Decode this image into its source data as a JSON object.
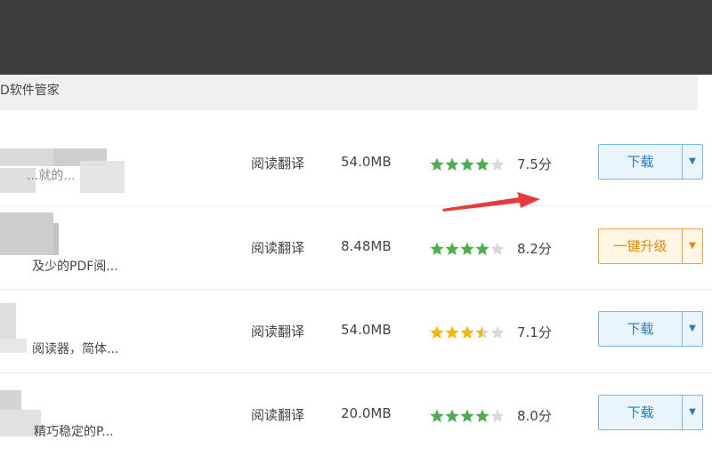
{
  "header": {
    "title": "D软件管家"
  },
  "rows": [
    {
      "desc": "...就的...",
      "category": "阅读翻译",
      "size": "54.0MB",
      "rating": 4,
      "score": "7.5分",
      "action": "下载",
      "action_type": "download"
    },
    {
      "desc": "及少的PDF阅...",
      "category": "阅读翻译",
      "size": "8.48MB",
      "rating": 4,
      "score": "8.2分",
      "action": "一键升级",
      "action_type": "upgrade"
    },
    {
      "desc": "阅读器，简体...",
      "category": "阅读翻译",
      "size": "54.0MB",
      "rating": 3.5,
      "score": "7.1分",
      "action": "下载",
      "action_type": "download"
    },
    {
      "desc": "精巧稳定的P...",
      "category": "阅读翻译",
      "size": "20.0MB",
      "rating": 4,
      "score": "8.0分",
      "action": "下载",
      "action_type": "download"
    }
  ],
  "icons": {
    "dropdown": "chevron-down-icon",
    "annotation": "red-arrow-annotation"
  },
  "colors": {
    "star_green": "#4cae4c",
    "star_yellow": "#f5b800",
    "star_empty": "#d9d9d9",
    "annotation": "#e83a3a",
    "download_border": "#7ab8dd",
    "upgrade_border": "#f0a43b"
  }
}
